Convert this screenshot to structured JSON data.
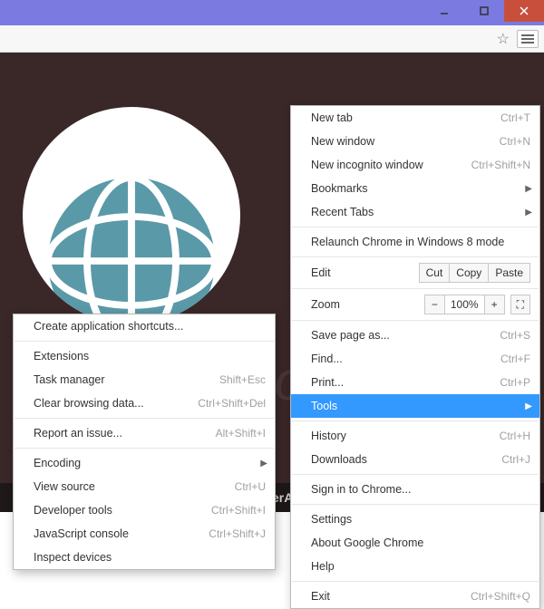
{
  "brand_bg": "#3a2727",
  "menu": {
    "new_tab": "New tab",
    "new_tab_sc": "Ctrl+T",
    "new_window": "New window",
    "new_window_sc": "Ctrl+N",
    "incognito": "New incognito window",
    "incognito_sc": "Ctrl+Shift+N",
    "bookmarks": "Bookmarks",
    "recent": "Recent Tabs",
    "relaunch": "Relaunch Chrome in Windows 8 mode",
    "edit": "Edit",
    "cut": "Cut",
    "copy": "Copy",
    "paste": "Paste",
    "zoom": "Zoom",
    "minus": "−",
    "pct": "100%",
    "plus": "+",
    "save": "Save page as...",
    "save_sc": "Ctrl+S",
    "find": "Find...",
    "find_sc": "Ctrl+F",
    "print": "Print...",
    "print_sc": "Ctrl+P",
    "tools": "Tools",
    "history": "History",
    "history_sc": "Ctrl+H",
    "downloads": "Downloads",
    "downloads_sc": "Ctrl+J",
    "signin": "Sign in to Chrome...",
    "settings": "Settings",
    "about": "About Google Chrome",
    "help": "Help",
    "exit": "Exit",
    "exit_sc": "Ctrl+Shift+Q"
  },
  "sub": {
    "create_shortcuts": "Create application shortcuts...",
    "extensions": "Extensions",
    "task_mgr": "Task manager",
    "task_mgr_sc": "Shift+Esc",
    "clear": "Clear browsing data...",
    "clear_sc": "Ctrl+Shift+Del",
    "report": "Report an issue...",
    "report_sc": "Alt+Shift+I",
    "encoding": "Encoding",
    "view_src": "View source",
    "view_src_sc": "Ctrl+U",
    "devtools": "Developer tools",
    "devtools_sc": "Ctrl+Shift+I",
    "js_console": "JavaScript console",
    "js_console_sc": "Ctrl+Shift+J",
    "inspect": "Inspect devices"
  },
  "footer": "erArmor",
  "watermark": "k.com"
}
